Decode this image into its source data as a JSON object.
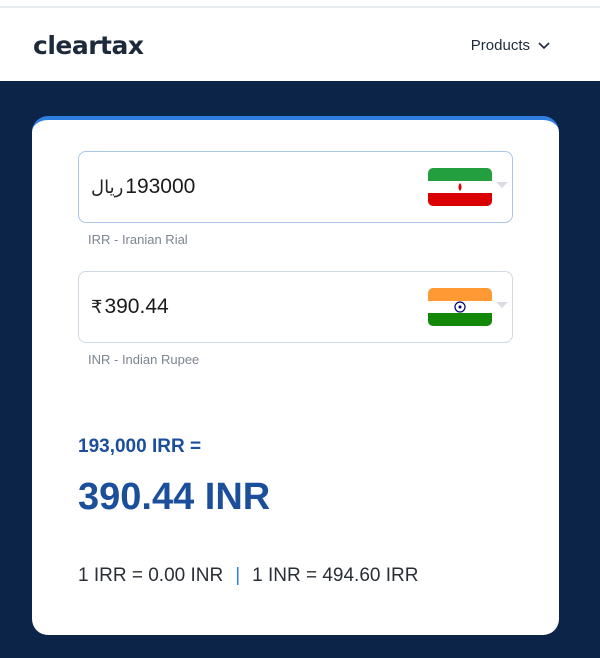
{
  "header": {
    "logo": "cleartax",
    "products_label": "Products"
  },
  "converter": {
    "from": {
      "symbol": "ریال",
      "amount": "193000",
      "currency_label": "IRR - Iranian Rial",
      "flag": "iran-flag"
    },
    "to": {
      "symbol": "₹",
      "amount": "390.44",
      "currency_label": "INR - Indian Rupee",
      "flag": "india-flag"
    },
    "result_source": "193,000 IRR =",
    "result_target": "390.44 INR",
    "rate_forward": "1 IRR = 0.00 INR",
    "rate_separator": "|",
    "rate_reverse": "1 INR = 494.60 IRR"
  },
  "colors": {
    "dark_bg": "#0b2447",
    "accent": "#1b4f9c",
    "card_top_border": "#2f7fe0"
  }
}
